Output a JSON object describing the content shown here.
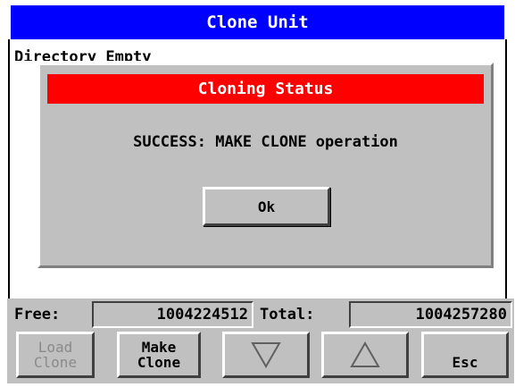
{
  "window": {
    "title": "Clone Unit"
  },
  "main": {
    "directory_text": "Directory Empty"
  },
  "dialog": {
    "title": "Cloning Status",
    "message": "SUCCESS: MAKE CLONE operation",
    "ok_label": "Ok"
  },
  "status": {
    "free_label": "Free:",
    "free_value": "1004224512",
    "total_label": "Total:",
    "total_value": "1004257280"
  },
  "toolbar": {
    "load_clone_line1": "Load",
    "load_clone_line2": "Clone",
    "make_clone_line1": "Make",
    "make_clone_line2": "Clone",
    "down_icon": "triangle-down-icon",
    "up_icon": "triangle-up-icon",
    "esc_label": "Esc"
  },
  "colors": {
    "title_bar": "#0000ff",
    "dialog_title": "#ff0000",
    "panel": "#c0c0c0"
  }
}
